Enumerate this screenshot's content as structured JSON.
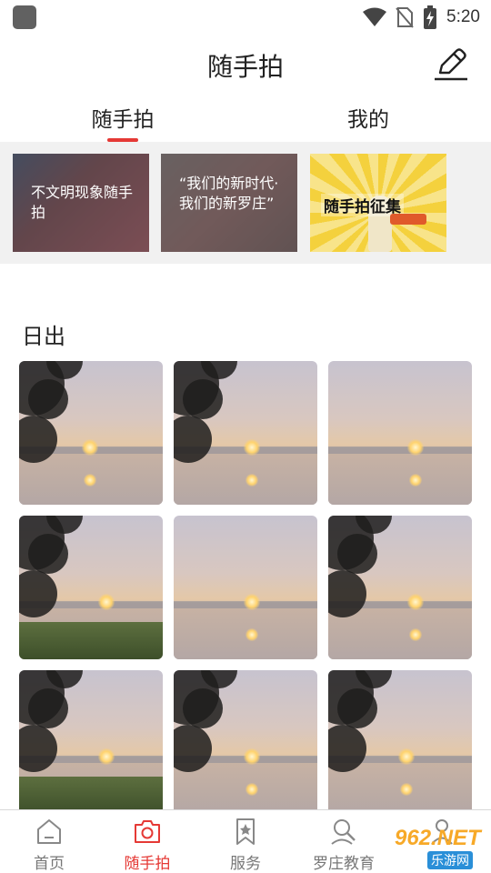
{
  "status_bar": {
    "time": "5:20",
    "icons": [
      "app-icon",
      "wifi-icon",
      "no-sim-icon",
      "battery-icon"
    ]
  },
  "header": {
    "title": "随手拍",
    "edit_icon": "pencil-icon"
  },
  "tabs": [
    {
      "label": "随手拍",
      "active": true
    },
    {
      "label": "我的",
      "active": false
    }
  ],
  "banners": [
    {
      "text": "不文明现象随手拍"
    },
    {
      "text": "“我们的新时代·我们的新罗庄”"
    },
    {
      "text": "随手拍征集"
    }
  ],
  "section": {
    "title": "日出"
  },
  "photos": [
    {
      "sun": "mid-left",
      "tree": true,
      "grass": false
    },
    {
      "sun": "mid",
      "tree": true,
      "grass": false
    },
    {
      "sun": "right",
      "tree": false,
      "grass": false
    },
    {
      "sun": "right",
      "tree": true,
      "grass": true
    },
    {
      "sun": "mid",
      "tree": false,
      "grass": false
    },
    {
      "sun": "right",
      "tree": true,
      "grass": false
    },
    {
      "sun": "right",
      "tree": true,
      "grass": true
    },
    {
      "sun": "mid",
      "tree": true,
      "grass": false
    },
    {
      "sun": "mid",
      "tree": true,
      "grass": false
    }
  ],
  "bottom_nav": [
    {
      "label": "首页",
      "icon": "home-icon",
      "active": false
    },
    {
      "label": "随手拍",
      "icon": "camera-icon",
      "active": true
    },
    {
      "label": "服务",
      "icon": "bookmark-star-icon",
      "active": false
    },
    {
      "label": "罗庄教育",
      "icon": "search-person-icon",
      "active": false
    },
    {
      "label": "",
      "icon": "person-icon",
      "active": false
    }
  ],
  "watermark": {
    "text": "962.NET",
    "sub": "乐游网"
  },
  "colors": {
    "accent": "#e53935",
    "banner_bg": "#f1f1f1"
  }
}
